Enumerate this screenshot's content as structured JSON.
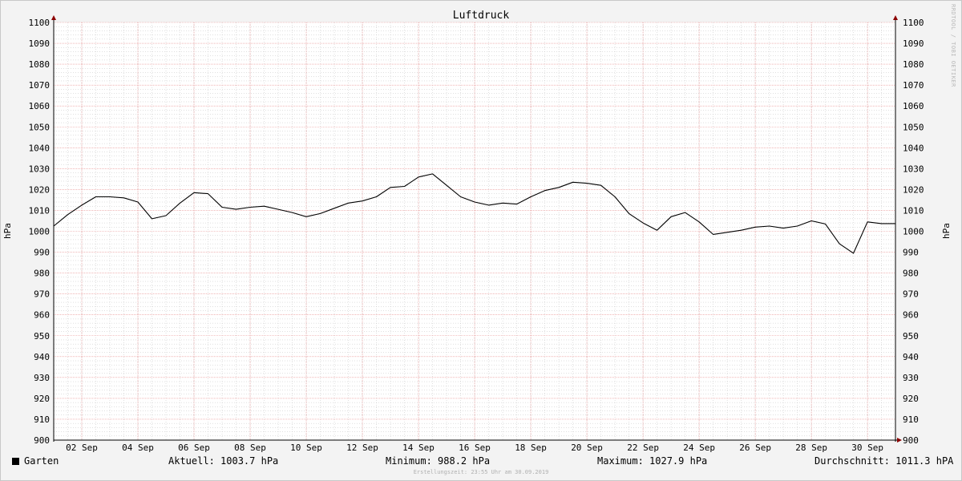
{
  "chart_data": {
    "type": "line",
    "title": "Luftdruck",
    "ylabel": "hPa",
    "ylim": [
      900,
      1100
    ],
    "y_ticks": [
      900,
      910,
      920,
      930,
      940,
      950,
      960,
      970,
      980,
      990,
      1000,
      1010,
      1020,
      1030,
      1040,
      1050,
      1060,
      1070,
      1080,
      1090,
      1100
    ],
    "x_start": "2019-09-01T00:00",
    "x_end": "2019-09-30T23:55",
    "x_tick_labels": [
      "02 Sep",
      "04 Sep",
      "06 Sep",
      "08 Sep",
      "10 Sep",
      "12 Sep",
      "14 Sep",
      "16 Sep",
      "18 Sep",
      "20 Sep",
      "22 Sep",
      "24 Sep",
      "26 Sep",
      "28 Sep",
      "30 Sep"
    ],
    "x_tick_dates": [
      "2019-09-02",
      "2019-09-04",
      "2019-09-06",
      "2019-09-08",
      "2019-09-10",
      "2019-09-12",
      "2019-09-14",
      "2019-09-16",
      "2019-09-18",
      "2019-09-20",
      "2019-09-22",
      "2019-09-24",
      "2019-09-26",
      "2019-09-28",
      "2019-09-30"
    ],
    "grid": true,
    "legend_position": "bottom-left",
    "series": [
      {
        "name": "Garten",
        "color": "#000000",
        "x": [
          "2019-09-01T00:00",
          "2019-09-01T12:00",
          "2019-09-02T00:00",
          "2019-09-02T12:00",
          "2019-09-03T00:00",
          "2019-09-03T12:00",
          "2019-09-04T00:00",
          "2019-09-04T12:00",
          "2019-09-05T00:00",
          "2019-09-05T12:00",
          "2019-09-06T00:00",
          "2019-09-06T12:00",
          "2019-09-07T00:00",
          "2019-09-07T12:00",
          "2019-09-08T00:00",
          "2019-09-08T12:00",
          "2019-09-09T00:00",
          "2019-09-09T12:00",
          "2019-09-10T00:00",
          "2019-09-10T12:00",
          "2019-09-11T00:00",
          "2019-09-11T12:00",
          "2019-09-12T00:00",
          "2019-09-12T12:00",
          "2019-09-13T00:00",
          "2019-09-13T12:00",
          "2019-09-14T00:00",
          "2019-09-14T12:00",
          "2019-09-15T00:00",
          "2019-09-15T12:00",
          "2019-09-16T00:00",
          "2019-09-16T12:00",
          "2019-09-17T00:00",
          "2019-09-17T12:00",
          "2019-09-18T00:00",
          "2019-09-18T12:00",
          "2019-09-19T00:00",
          "2019-09-19T12:00",
          "2019-09-20T00:00",
          "2019-09-20T12:00",
          "2019-09-21T00:00",
          "2019-09-21T12:00",
          "2019-09-22T00:00",
          "2019-09-22T12:00",
          "2019-09-23T00:00",
          "2019-09-23T12:00",
          "2019-09-24T00:00",
          "2019-09-24T12:00",
          "2019-09-25T00:00",
          "2019-09-25T12:00",
          "2019-09-26T00:00",
          "2019-09-26T12:00",
          "2019-09-27T00:00",
          "2019-09-27T12:00",
          "2019-09-28T00:00",
          "2019-09-28T12:00",
          "2019-09-29T00:00",
          "2019-09-29T12:00",
          "2019-09-30T00:00",
          "2019-09-30T12:00",
          "2019-09-30T23:55"
        ],
        "y": [
          1002.5,
          1008,
          1012.5,
          1016.5,
          1016.5,
          1016,
          1014,
          1006,
          1007.5,
          1013.5,
          1018.5,
          1018,
          1011.5,
          1010.5,
          1011.5,
          1012,
          1010.5,
          1009,
          1007,
          1008.5,
          1011,
          1013.5,
          1014.5,
          1016.5,
          1021,
          1021.5,
          1026,
          1027.5,
          1022,
          1016.5,
          1014,
          1012.5,
          1013.5,
          1013,
          1016.5,
          1019.5,
          1021,
          1023.5,
          1023,
          1022,
          1016.5,
          1008.5,
          1004,
          1000.5,
          1007,
          1009,
          1004.5,
          998.5,
          999.5,
          1000.5,
          1002,
          1002.5,
          1001.5,
          1002.5,
          1005,
          1003.5,
          994,
          989.5,
          1004.5,
          1003.7,
          1003.7
        ]
      }
    ],
    "legend": {
      "series_label": "Garten",
      "aktuell": "Aktuell: 1003.7 hPa",
      "minimum": "Minimum: 988.2 hPa",
      "maximum": "Maximum: 1027.9 hPa",
      "durchschnitt": "Durchschnitt: 1011.3 hPA"
    },
    "footer": "Erstellungszeit: 23:55 Uhr am 30.09.2019",
    "watermark": "RRDTOOL / TOBI OETIKER",
    "colors": {
      "background": "#f3f3f3",
      "plot_background": "#ffffff",
      "major_grid": "#e88a8a",
      "minor_grid": "#c0c0c0",
      "axis_arrow": "#8b0000",
      "line": "#000000"
    }
  }
}
